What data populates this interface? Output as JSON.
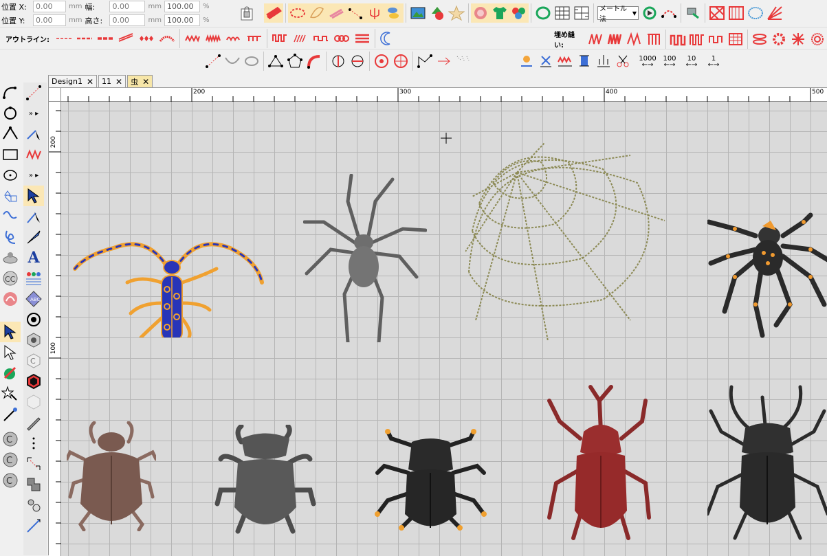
{
  "position_panel": {
    "pos_x_label": "位置 X:",
    "pos_y_label": "位置 Y:",
    "pos_x_value": "0.00",
    "pos_y_value": "0.00",
    "width_label": "幅:",
    "height_label": "高さ:",
    "width_value": "0.00",
    "height_value": "0.00",
    "unit_mm": "mm",
    "scale_w": "100.00",
    "scale_h": "100.00",
    "unit_percent": "%"
  },
  "unit_select": {
    "value": "メートル法"
  },
  "outline_bar": {
    "label": "アウトライン:"
  },
  "fill_bar": {
    "label": "埋め縫い:"
  },
  "stitch_counts": [
    "1000",
    "100",
    "10",
    "1"
  ],
  "tabs": [
    {
      "label": "Design1",
      "close": "✕"
    },
    {
      "label": "11",
      "close": "✕"
    },
    {
      "label": "虫",
      "close": "✕"
    }
  ],
  "ruler": {
    "h_labels": [
      "200",
      "300",
      "400",
      "500"
    ],
    "v_labels": [
      "200",
      "100"
    ]
  },
  "design_objects": [
    "longhorn-beetle",
    "gray-spider",
    "spider-web",
    "orange-spotted-spider",
    "brown-beetle",
    "gray-stag-beetle",
    "black-scarab",
    "red-rhino-beetle",
    "black-atlas-beetle"
  ],
  "colors": {
    "accent_red": "#e8393a",
    "tab_active": "#f7e6a8",
    "canvas_bg": "#dadada",
    "grid": "#b9b9b9"
  }
}
